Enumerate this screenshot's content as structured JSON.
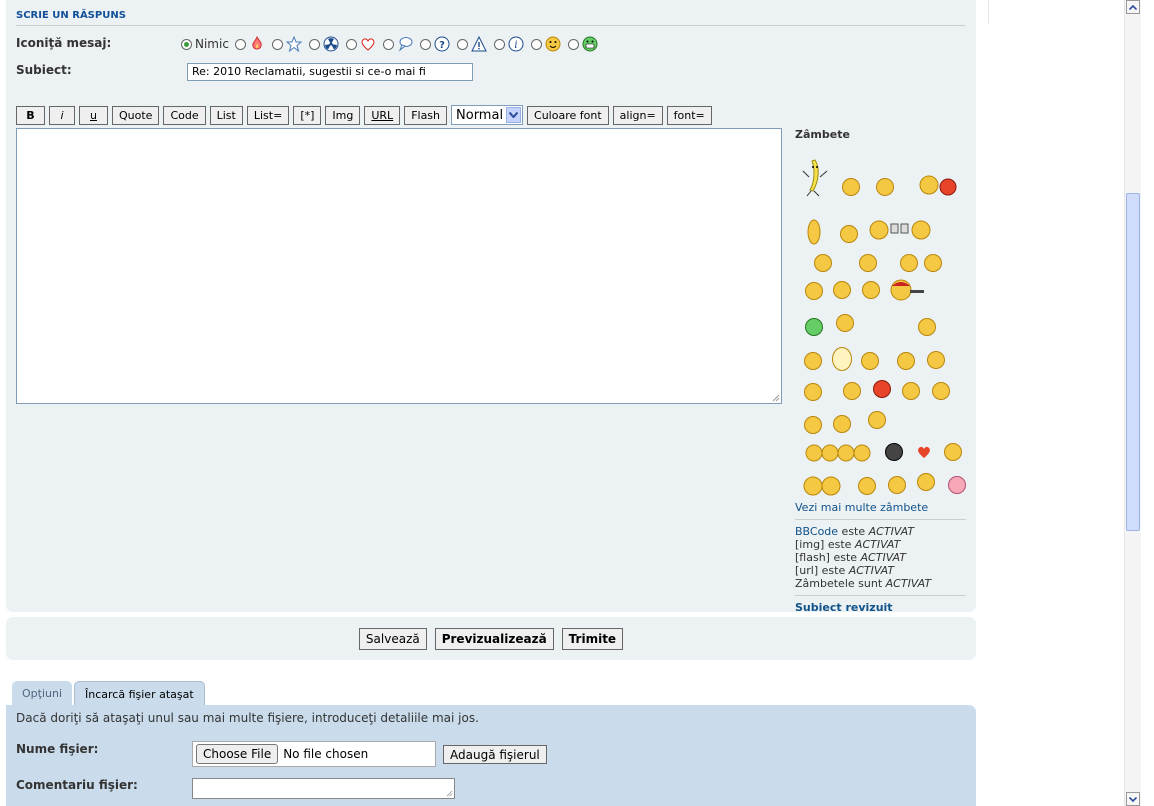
{
  "section_title": "Scrie un răspuns",
  "message_icon": {
    "label": "Iconiţă mesaj:",
    "none_label": "Nimic",
    "options": [
      "fire-icon",
      "star-icon",
      "radioactive-icon",
      "heart-icon",
      "speech-bubble-icon",
      "question-icon",
      "warning-icon",
      "info-icon",
      "smiley-icon",
      "grin-icon"
    ]
  },
  "subject": {
    "label": "Subiect:",
    "value": "Re: 2010 Reclamatii, sugestii si ce-o mai fi"
  },
  "toolbar": {
    "buttons": [
      "B",
      "i",
      "u",
      "Quote",
      "Code",
      "List",
      "List=",
      "[*]",
      "Img",
      "URL",
      "Flash"
    ],
    "font_size": "Normal",
    "buttons_after": [
      "Culoare font",
      "align=",
      "font="
    ]
  },
  "sidebar": {
    "title": "Zâmbete",
    "more_smileys": "Vezi mai multe zâmbete",
    "bbcode_link": "BBCode",
    "bbcode_rest": " este ",
    "status_active": "ACTIVAT",
    "img_label": "[img] este ",
    "flash_label": "[flash] este ",
    "url_label": "[url] este ",
    "smileys_label": "Zâmbetele sunt ",
    "revised_subject": "Subiect revizuit"
  },
  "actions": {
    "save": "Salvează",
    "preview": "Previzualizează",
    "submit": "Trimite"
  },
  "tabs": {
    "options": "Opţiuni",
    "upload": "Încarcă fişier ataşat"
  },
  "attachment": {
    "intro": "Dacă doriţi să ataşaţi unul sau mai multe fişiere, introduceţi detaliile mai jos.",
    "filename_label": "Nume fişier:",
    "choose_file": "Choose File",
    "no_file": "No file chosen",
    "add_file": "Adaugă fişierul",
    "comment_label": "Comentariu fişier:"
  }
}
